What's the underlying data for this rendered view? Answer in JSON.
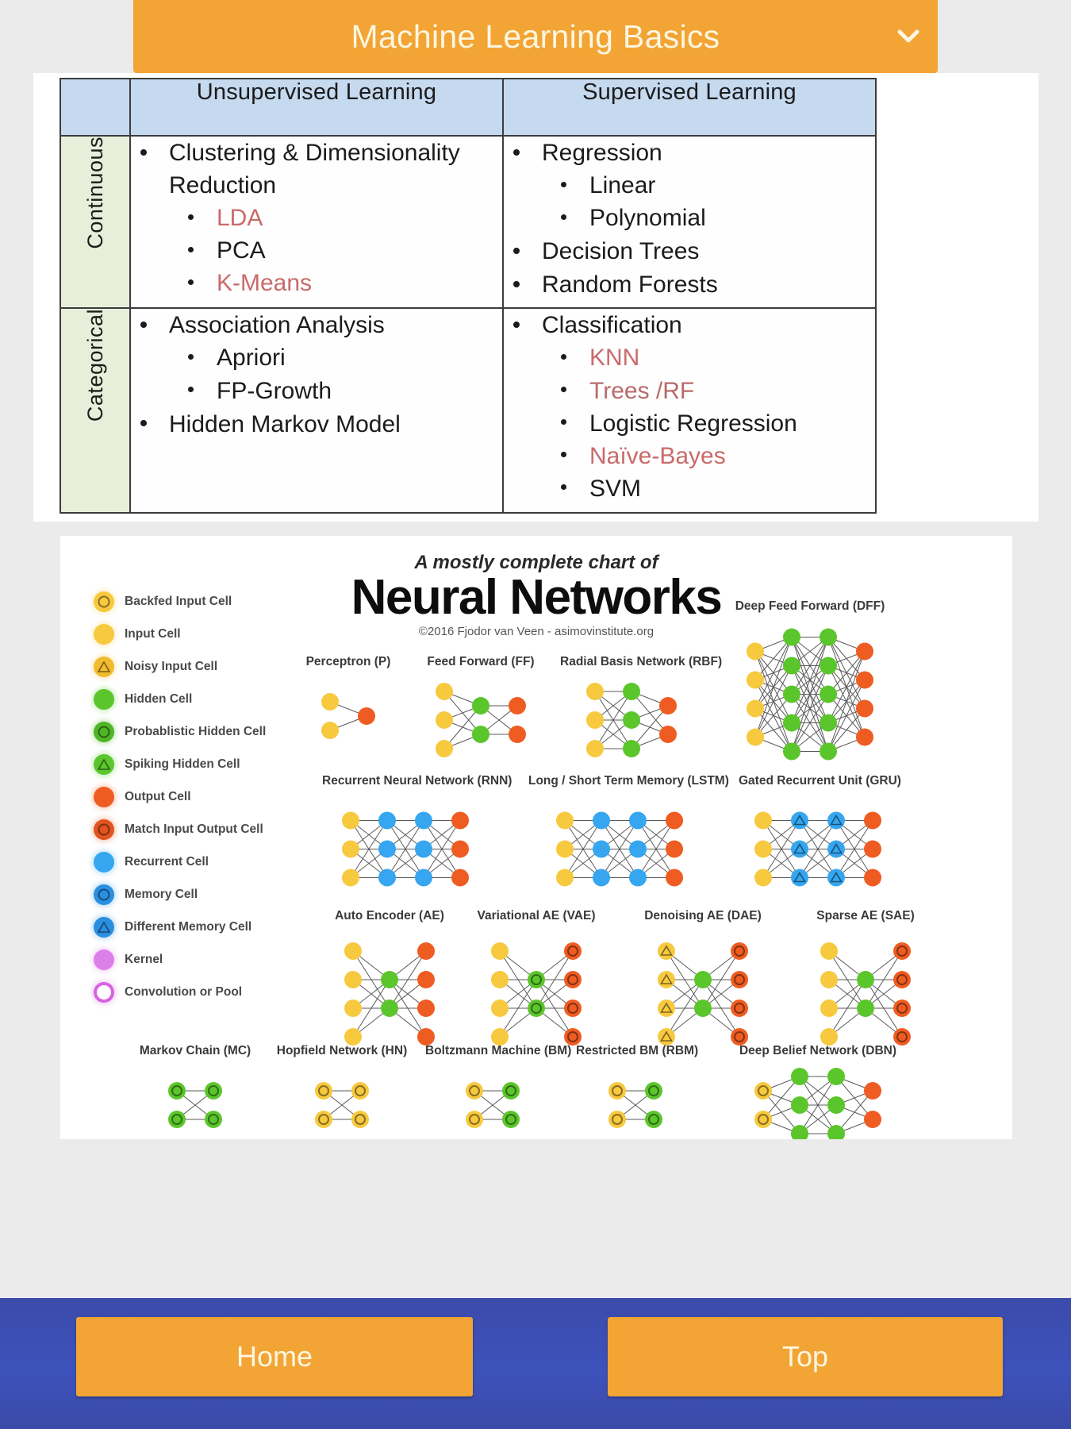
{
  "header": {
    "title": "Machine Learning Basics",
    "chevron_icon": "chevron-down-icon",
    "bg_color": "#f2a435",
    "text_color": "#fdf6e0"
  },
  "table": {
    "column_headers": [
      "",
      "Unsupervised Learning",
      "Supervised Learning"
    ],
    "header_bg": "#c5d9ef",
    "rowlabel_bg": "#e7efda",
    "highlight_color": "#c96a6a",
    "rows": [
      {
        "label": "Continuous",
        "unsupervised": [
          {
            "text": "Clustering & Dimensionality Reduction",
            "highlight": false,
            "children": [
              {
                "text": "LDA",
                "highlight": true
              },
              {
                "text": "PCA",
                "highlight": false
              },
              {
                "text": "K-Means",
                "highlight": true
              }
            ]
          }
        ],
        "supervised": [
          {
            "text": "Regression",
            "highlight": false,
            "children": [
              {
                "text": "Linear",
                "highlight": false
              },
              {
                "text": "Polynomial",
                "highlight": false
              }
            ]
          },
          {
            "text": "Decision Trees",
            "highlight": false,
            "children": []
          },
          {
            "text": "Random Forests",
            "highlight": false,
            "children": []
          }
        ]
      },
      {
        "label": "Categorical",
        "unsupervised": [
          {
            "text": "Association Analysis",
            "highlight": false,
            "children": [
              {
                "text": "Apriori",
                "highlight": false
              },
              {
                "text": "FP-Growth",
                "highlight": false
              }
            ]
          },
          {
            "text": "Hidden Markov Model",
            "highlight": false,
            "children": []
          }
        ],
        "supervised": [
          {
            "text": "Classification",
            "highlight": false,
            "children": [
              {
                "text": "KNN",
                "highlight": true
              },
              {
                "text": "Trees /RF",
                "highlight": "partial"
              },
              {
                "text": "Logistic Regression",
                "highlight": false
              },
              {
                "text": "Naïve-Bayes",
                "highlight": true
              },
              {
                "text": "SVM",
                "highlight": false
              }
            ]
          }
        ]
      }
    ]
  },
  "neural_chart": {
    "subtitle": "A mostly complete chart of",
    "title": "Neural Networks",
    "credit": "©2016 Fjodor van Veen - asimovinstitute.org",
    "legend": [
      {
        "label": "Backfed Input Cell",
        "color": "#f7c93e",
        "style": "ring"
      },
      {
        "label": "Input Cell",
        "color": "#f7c93e",
        "style": "solid"
      },
      {
        "label": "Noisy Input Cell",
        "color": "#f0bb2e",
        "style": "triangle"
      },
      {
        "label": "Hidden Cell",
        "color": "#5bc62b",
        "style": "solid"
      },
      {
        "label": "Probablistic Hidden Cell",
        "color": "#4fb526",
        "style": "ring"
      },
      {
        "label": "Spiking Hidden Cell",
        "color": "#5bc62b",
        "style": "triangle"
      },
      {
        "label": "Output Cell",
        "color": "#ef5c22",
        "style": "solid"
      },
      {
        "label": "Match Input Output Cell",
        "color": "#e2541f",
        "style": "ring"
      },
      {
        "label": "Recurrent Cell",
        "color": "#35a6ef",
        "style": "solid"
      },
      {
        "label": "Memory Cell",
        "color": "#2b8fe0",
        "style": "ring"
      },
      {
        "label": "Different Memory Cell",
        "color": "#2b8fe0",
        "style": "triangle"
      },
      {
        "label": "Kernel",
        "color": "#dd7fe8",
        "style": "solid"
      },
      {
        "label": "Convolution or Pool",
        "color": "#d763e0",
        "style": "hollow"
      }
    ],
    "networks": [
      {
        "name": "Perceptron (P)"
      },
      {
        "name": "Feed Forward (FF)"
      },
      {
        "name": "Radial Basis Network (RBF)"
      },
      {
        "name": "Deep Feed Forward (DFF)"
      },
      {
        "name": "Recurrent Neural Network (RNN)"
      },
      {
        "name": "Long / Short Term Memory (LSTM)"
      },
      {
        "name": "Gated Recurrent Unit (GRU)"
      },
      {
        "name": "Auto Encoder (AE)"
      },
      {
        "name": "Variational AE (VAE)"
      },
      {
        "name": "Denoising AE (DAE)"
      },
      {
        "name": "Sparse AE (SAE)"
      },
      {
        "name": "Markov Chain (MC)"
      },
      {
        "name": "Hopfield Network (HN)"
      },
      {
        "name": "Boltzmann Machine (BM)"
      },
      {
        "name": "Restricted BM (RBM)"
      },
      {
        "name": "Deep Belief Network (DBN)"
      }
    ],
    "colors": {
      "input": "#f7c93e",
      "hidden": "#5bc62b",
      "output": "#ef5c22",
      "recurrent": "#35a6ef",
      "kernel": "#dd7fe8"
    }
  },
  "bottom_nav": {
    "home_label": "Home",
    "top_label": "Top",
    "bg_color": "#3c4fb2",
    "button_color": "#f2a435"
  }
}
